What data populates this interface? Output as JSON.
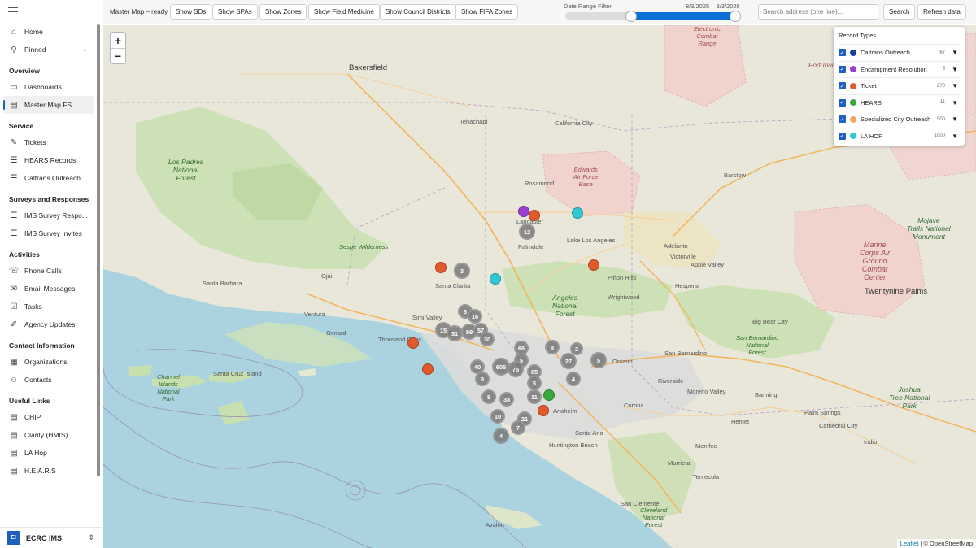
{
  "sidebar": {
    "items_top": [
      {
        "label": "Home",
        "icon": "home-icon"
      },
      {
        "label": "Pinned",
        "icon": "pin-icon"
      }
    ],
    "sections": [
      {
        "title": "Overview",
        "items": [
          {
            "label": "Dashboards",
            "icon": "dashboard-icon"
          },
          {
            "label": "Master Map FS",
            "icon": "document-icon",
            "active": true
          }
        ]
      },
      {
        "title": "Service",
        "items": [
          {
            "label": "Tickets",
            "icon": "wrench-icon"
          },
          {
            "label": "HEARS Records",
            "icon": "list-icon"
          },
          {
            "label": "Caltrans Outreach...",
            "icon": "list-icon"
          }
        ]
      },
      {
        "title": "Surveys and Responses",
        "items": [
          {
            "label": "IMS Survey Respo...",
            "icon": "list-icon"
          },
          {
            "label": "IMS Survey Invites",
            "icon": "list-icon"
          }
        ]
      },
      {
        "title": "Activities",
        "items": [
          {
            "label": "Phone Calls",
            "icon": "phone-icon"
          },
          {
            "label": "Email Messages",
            "icon": "mail-icon"
          },
          {
            "label": "Tasks",
            "icon": "task-icon"
          },
          {
            "label": "Agency Updates",
            "icon": "edit-icon"
          }
        ]
      },
      {
        "title": "Contact Information",
        "items": [
          {
            "label": "Organizations",
            "icon": "building-icon"
          },
          {
            "label": "Contacts",
            "icon": "person-icon"
          }
        ]
      },
      {
        "title": "Useful Links",
        "items": [
          {
            "label": "CHIP",
            "icon": "document-icon"
          },
          {
            "label": "Clarity (HMIS)",
            "icon": "document-icon"
          },
          {
            "label": "LA Hop",
            "icon": "document-icon"
          },
          {
            "label": "H.E.A.R.S",
            "icon": "document-icon"
          }
        ]
      }
    ],
    "app": {
      "logo": "EI",
      "name": "ECRC IMS"
    }
  },
  "toolbar": {
    "status": "Master Map – ready.",
    "buttons": [
      "Show SDs",
      "Show SPAs",
      "Show Zones",
      "Show Field Medicine",
      "Show Council Districts",
      "Show FIFA Zones"
    ],
    "date_range_label": "Date Range Filter",
    "date_range_values": "8/3/2025 – 8/3/2026",
    "date_range_fill_start": 0.38,
    "date_range_fill_end": 0.98,
    "search_placeholder": "Search address (one line)...",
    "search_button": "Search",
    "refresh_button": "Refresh data"
  },
  "map": {
    "zoom_in": "+",
    "zoom_out": "−",
    "attribution_link": "Leaflet",
    "attribution_text": " | © OpenStreetMap",
    "legend": {
      "title": "Record Types",
      "items": [
        {
          "label": "Caltrans Outreach",
          "count": "67",
          "color": "#1a3fa0"
        },
        {
          "label": "Encampment Resolution",
          "count": "5",
          "color": "#9b3fd1"
        },
        {
          "label": "Ticket",
          "count": "270",
          "color": "#e05a2b"
        },
        {
          "label": "HEARS",
          "count": "11",
          "color": "#3aa83a"
        },
        {
          "label": "Specialized City Outreach",
          "count": "500",
          "color": "#f0a860"
        },
        {
          "label": "LA HOP",
          "count": "1000",
          "color": "#2fc9d6"
        }
      ]
    },
    "places": {
      "bakersfield": "Bakersfield",
      "lancaster": "Lancaster",
      "palmdale": "Palmdale",
      "santa_clarita": "Santa Clarita",
      "victorville": "Victorville",
      "hesperia": "Hesperia",
      "barstow": "Barstow",
      "adelanto": "Adelanto",
      "lake_los_angeles": "Lake Los Angeles",
      "rosamond": "Rosamond",
      "santa_barbara": "Santa Barbara",
      "ventura": "Ventura",
      "oxnard": "Oxnard",
      "thousand_oaks": "Thousand Oaks",
      "simi_valley": "Simi Valley",
      "san_bernardino": "San Bernardino",
      "riverside": "Riverside",
      "ontario": "Ontario",
      "anaheim": "Anaheim",
      "santa_ana": "Santa Ana",
      "huntington_beach": "Huntington Beach",
      "corona": "Corona",
      "moreno_valley": "Moreno Valley",
      "hemet": "Hemet",
      "temecula": "Temecula",
      "palm_springs": "Palm Springs",
      "indio": "Indio",
      "san_clemente": "San Clemente",
      "avalon": "Avalon",
      "santa_cruz_island": "Santa Cruz Island",
      "big_bear_city": "Big Bear City",
      "apple_valley": "Apple Valley",
      "murrieta": "Murrieta",
      "menifee": "Menifee",
      "banning": "Banning",
      "cathedral_city": "Cathedral City",
      "twentynine_palms": "Twentynine Palms",
      "california_city": "California City",
      "tehachapi": "Tehachapi",
      "ojai": "Ojai",
      "pinon_hills": "Piñon Hills",
      "wrightwood": "Wrightwood"
    },
    "parks": {
      "los_padres": "Los Padres\nNational\nForest",
      "angeles": "Angeles\nNational\nForest",
      "san_bernardino_nf": "San Bernardino\nNational\nForest",
      "channel_islands": "Channel\nIslands\nNational\nPark",
      "joshua_tree": "Joshua\nTree National\nPark",
      "mojave_trails": "Mojave\nTrails National\nMonument",
      "cleveland": "Cleveland\nNational\nForest",
      "sespe": "Sespe Wilderness"
    },
    "military": {
      "edwards": "Edwards\nAir Force\nBase",
      "twentynine_palms_base": "Marine\nCorps Air\nGround\nCombat\nCenter",
      "fort_irwin": "Fort Irwin",
      "china_lake": "Electronic\nCombat\nRange"
    },
    "clusters": [
      {
        "label": "12"
      },
      {
        "label": "3"
      },
      {
        "label": "3"
      },
      {
        "label": "16"
      },
      {
        "label": "15"
      },
      {
        "label": "31"
      },
      {
        "label": "99"
      },
      {
        "label": "57"
      },
      {
        "label": "30"
      },
      {
        "label": "66"
      },
      {
        "label": "8"
      },
      {
        "label": "2"
      },
      {
        "label": "5"
      },
      {
        "label": "27"
      },
      {
        "label": "5"
      },
      {
        "label": "605"
      },
      {
        "label": "75"
      },
      {
        "label": "65"
      },
      {
        "label": "4"
      },
      {
        "label": "40"
      },
      {
        "label": "9"
      },
      {
        "label": "8"
      },
      {
        "label": "38"
      },
      {
        "label": "11"
      },
      {
        "label": "10"
      },
      {
        "label": "21"
      },
      {
        "label": "7"
      },
      {
        "label": "4"
      },
      {
        "label": "5"
      }
    ],
    "markers": [
      {
        "type": "Encampment Resolution"
      },
      {
        "type": "Ticket"
      },
      {
        "type": "LA HOP"
      },
      {
        "type": "Ticket"
      },
      {
        "type": "LA HOP"
      },
      {
        "type": "Ticket"
      },
      {
        "type": "Ticket"
      },
      {
        "type": "Ticket"
      },
      {
        "type": "Ticket"
      },
      {
        "type": "HEARS"
      }
    ]
  }
}
